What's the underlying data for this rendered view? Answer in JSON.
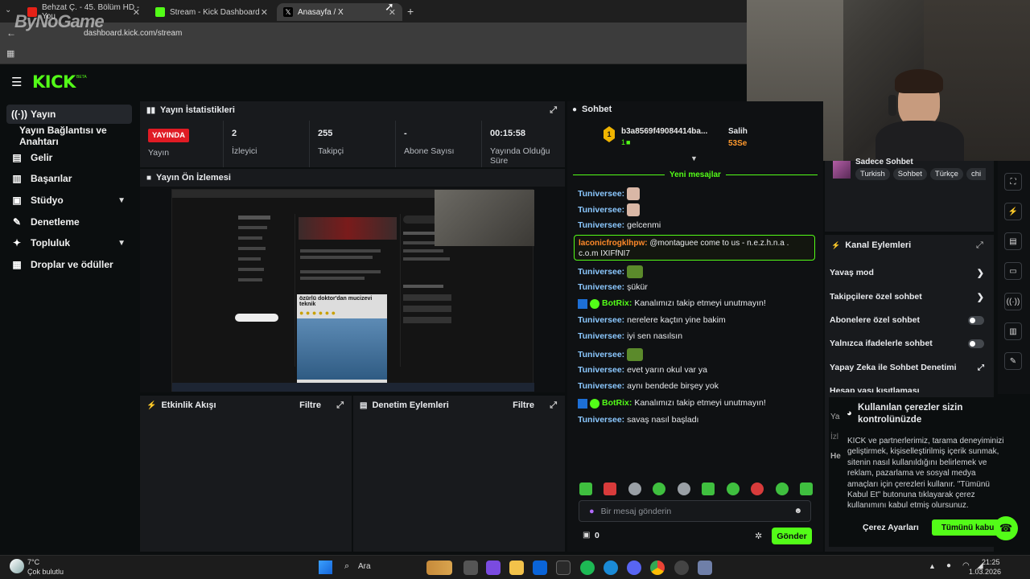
{
  "browser": {
    "tabs": [
      {
        "title": "Behzat Ç. - 45. Bölüm HD - You"
      },
      {
        "title": "Stream - Kick Dashboard"
      },
      {
        "title": "Anasayfa / X"
      }
    ],
    "url": "dashboard.kick.com/stream",
    "watermark": "ByNoGame"
  },
  "kick": {
    "logo": "KICK",
    "logo_sup": "BETA",
    "sidebar": [
      {
        "label": "Yayın"
      },
      {
        "label": "Yayın Bağlantısı ve Anahtarı"
      },
      {
        "label": "Gelir"
      },
      {
        "label": "Başarılar"
      },
      {
        "label": "Stüdyo"
      },
      {
        "label": "Denetleme"
      },
      {
        "label": "Topluluk"
      },
      {
        "label": "Droplar ve ödüller"
      }
    ],
    "stats_panel": {
      "title": "Yayın İstatistikleri",
      "live_badge": "YAYINDA",
      "live_label": "Yayın",
      "viewers_value": "2",
      "viewers_label": "İzleyici",
      "followers_value": "255",
      "followers_label": "Takipçi",
      "subs_value": "-",
      "subs_label": "Abone Sayısı",
      "uptime_value": "00:15:58",
      "uptime_label": "Yayında Olduğu Süre"
    },
    "preview_panel": {
      "title": "Yayın Ön İzlemesi",
      "preview_headline": "özürlü doktor'dan mucizevi teknik"
    },
    "activity_panel": {
      "title": "Etkinlik Akışı",
      "filter": "Filtre"
    },
    "mod_panel": {
      "title": "Denetim Eylemleri",
      "filter": "Filtre"
    },
    "chat": {
      "title": "Sohbet",
      "pinned_user": "b3a8569f49084414ba...",
      "pinned_count": "1",
      "pinned_rank": "1",
      "pinned_right_name": "Salih",
      "pinned_right_amount": "53Se",
      "new_messages": "Yeni mesajlar",
      "messages": [
        {
          "user": "Tuniversee:",
          "text": ""
        },
        {
          "user": "Tuniversee:",
          "text": ""
        },
        {
          "user": "Tuniversee:",
          "text": "gelcenmi"
        },
        {
          "user": "laconicfrogklhpw:",
          "text": "@montaguee come to us - n.e.z.h.n.a . c.o.m IXIFfNI7"
        },
        {
          "user": "Tuniversee:",
          "text": ""
        },
        {
          "user": "Tuniversee:",
          "text": "şükür"
        },
        {
          "user": "BotRix:",
          "text": "Kanalımızı takip etmeyi unutmayın!"
        },
        {
          "user": "Tuniversee:",
          "text": "nerelere kaçtın yine bakim"
        },
        {
          "user": "Tuniversee:",
          "text": "iyi sen nasılsın"
        },
        {
          "user": "Tuniversee:",
          "text": ""
        },
        {
          "user": "Tuniversee:",
          "text": "evet yarın okul var ya"
        },
        {
          "user": "Tuniversee:",
          "text": "aynı bendede birşey yok"
        },
        {
          "user": "BotRix:",
          "text": "Kanalımızı takip etmeyi unutmayın!"
        },
        {
          "user": "Tuniversee:",
          "text": "savaş nasıl başladı"
        }
      ],
      "input_placeholder": "Bir mesaj gönderin",
      "points": "0",
      "send": "Gönder"
    },
    "chat_settings": {
      "mode": "Sadece Sohbet",
      "tags": [
        "Turkish",
        "Sohbet",
        "Türkçe",
        "chi"
      ]
    },
    "channel_actions": {
      "title": "Kanal Eylemleri",
      "items": [
        {
          "label": "Yavaş mod"
        },
        {
          "label": "Takipçilere özel sohbet"
        },
        {
          "label": "Abonelere özel sohbet"
        },
        {
          "label": "Yalnızca ifadelerle sohbet"
        },
        {
          "label": "Yapay Zeka ile Sohbet Denetimi"
        },
        {
          "label": "Hesap yaşı kısıtlaması"
        }
      ]
    },
    "cookie": {
      "title": "Kullanılan çerezler sizin kontrolünüzde",
      "body": "KICK ve partnerlerimiz, tarama deneyiminizi geliştirmek, kişiselleştirilmiş içerik sunmak, sitenin nasıl kullanıldığını belirlemek ve reklam, pazarlama ve sosyal medya amaçları için çerezleri kullanır. \"Tümünü Kabul Et\" butonuna tıklayarak çerez kullanımını kabul etmiş olursunuz.",
      "settings": "Çerez Ayarları",
      "accept": "Tümünü kabul"
    }
  },
  "taskbar": {
    "weather_temp": "7°C",
    "weather_desc": "Çok bulutlu",
    "search": "Ara",
    "time": "21:25",
    "date": "1.03.2026"
  },
  "colors": {
    "kick_green": "#53fc18",
    "live_red": "#e01b24",
    "panel": "#181a1d"
  }
}
